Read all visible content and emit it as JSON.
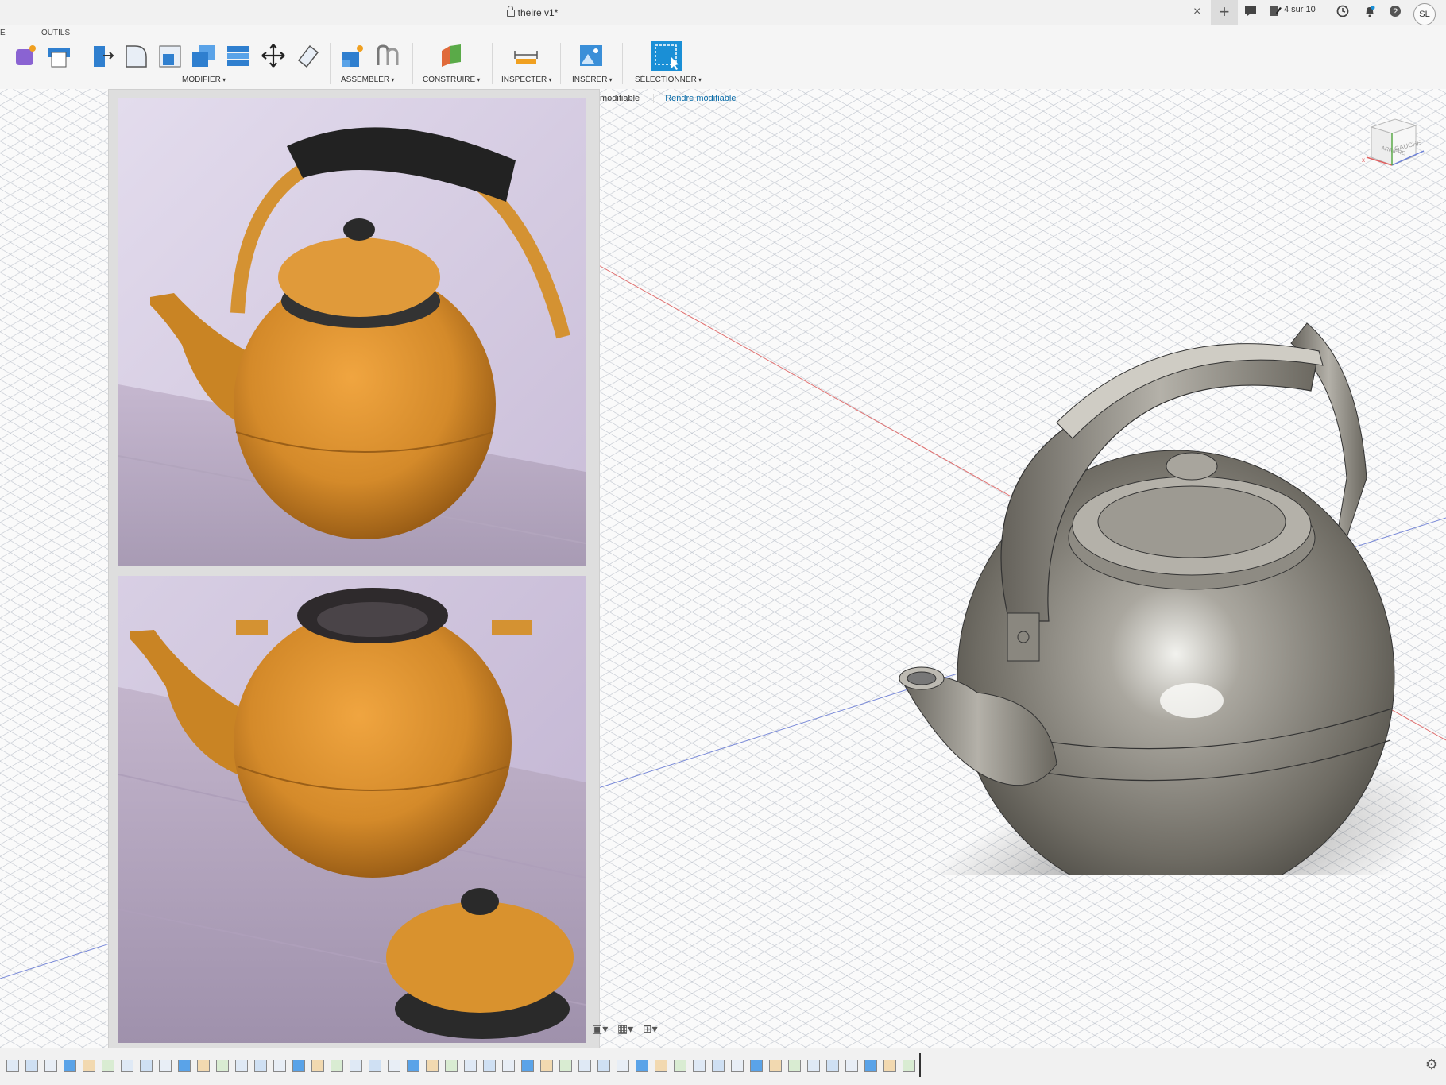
{
  "window": {
    "title": "theire v1*",
    "close_glyph": "×",
    "new_tab_glyph": "+",
    "jobs_status": "4 sur 10",
    "user_initials": "SL"
  },
  "toolbar": {
    "tab_partial": "E",
    "tab_tools": "OUTILS",
    "groups": {
      "modifier": "MODIFIER",
      "assembler": "ASSEMBLER",
      "construire": "CONSTRUIRE",
      "inspecter": "INSPECTER",
      "inserer": "INSÉRER",
      "selectionner": "SÉLECTIONNER"
    }
  },
  "inline_notice": {
    "text": "is modifiable",
    "link": "Rendre modifiable"
  },
  "viewcube": {
    "face_left": "ARRIÈRE",
    "face_right": "GAUCHE"
  },
  "colors": {
    "accent_blue": "#1a8fd6",
    "axis_red": "#e06060",
    "axis_blue": "#6a7fd8",
    "pla_orange": "#d48a2a",
    "model_grey": "#8a877f"
  },
  "icons": [
    "sketch-icon",
    "form-icon",
    "box-icon",
    "press-pull-icon",
    "fillet-icon",
    "shell-icon",
    "combine-icon",
    "offset-face-icon",
    "move-icon",
    "scale-icon",
    "new-component-icon",
    "joint-icon",
    "construct-plane-icon",
    "measure-icon",
    "insert-image-icon",
    "select-window-icon",
    "chat-icon",
    "jobs-icon",
    "history-icon",
    "bell-icon",
    "help-icon",
    "settings-icon"
  ]
}
